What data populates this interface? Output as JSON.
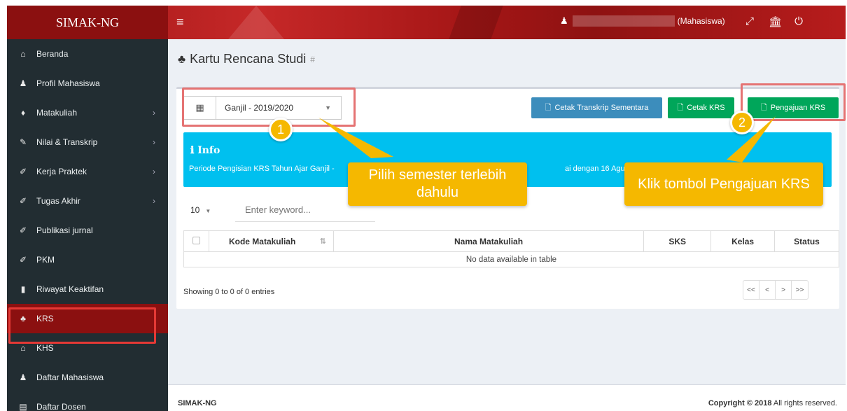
{
  "app": {
    "brand": "SIMAK-NG",
    "role": "(Mahasiswa)"
  },
  "icons": {
    "hamburger": "≡",
    "user": "♟",
    "expand": "⤢",
    "institution": "🏛",
    "power": "⏻",
    "calendar": "▦",
    "doc": "🗋"
  },
  "sidebar": {
    "items": [
      {
        "label": "Beranda",
        "icon": "home-icon",
        "glyph": "⌂",
        "chevron": false
      },
      {
        "label": "Profil Mahasiswa",
        "icon": "user-icon",
        "glyph": "♟",
        "chevron": false
      },
      {
        "label": "Matakuliah",
        "icon": "diamond-icon",
        "glyph": "♦",
        "chevron": true
      },
      {
        "label": "Nilai & Transkrip",
        "icon": "edit-icon",
        "glyph": "✎",
        "chevron": true
      },
      {
        "label": "Kerja Praktek",
        "icon": "pencil-icon",
        "glyph": "✐",
        "chevron": true
      },
      {
        "label": "Tugas Akhir",
        "icon": "pencil-icon",
        "glyph": "✐",
        "chevron": true
      },
      {
        "label": "Publikasi jurnal",
        "icon": "pencil-icon",
        "glyph": "✐",
        "chevron": false
      },
      {
        "label": "PKM",
        "icon": "pencil-icon",
        "glyph": "✐",
        "chevron": false
      },
      {
        "label": "Riwayat Keaktifan",
        "icon": "bookmark-icon",
        "glyph": "▮",
        "chevron": false
      },
      {
        "label": "KRS",
        "icon": "sitemap-icon",
        "glyph": "♣",
        "chevron": false,
        "active": true
      },
      {
        "label": "KHS",
        "icon": "graduation-icon",
        "glyph": "⌂",
        "chevron": false
      },
      {
        "label": "Daftar Mahasiswa",
        "icon": "users-icon",
        "glyph": "♟",
        "chevron": false
      },
      {
        "label": "Daftar Dosen",
        "icon": "list-icon",
        "glyph": "▤",
        "chevron": false
      }
    ],
    "chevron_glyph": "›"
  },
  "page": {
    "title": "Kartu Rencana Studi",
    "hash": "#",
    "title_icon": "♣"
  },
  "semester": {
    "value": "Ganjil - 2019/2020",
    "caret": "▼"
  },
  "buttons": {
    "cetak_transkrip": "Cetak Transkrip Sementara",
    "cetak_krs": "Cetak KRS",
    "pengajuan_krs": "Pengajuan KRS"
  },
  "info": {
    "title": "ℹ Info",
    "text_visible_left": "Periode Pengisian KRS Tahun Ajar Ganjil -",
    "text_visible_right": "ai dengan 16 Agust"
  },
  "table": {
    "length": "10",
    "length_caret": "▼",
    "search_placeholder": "Enter keyword...",
    "sort_icon": "⇅",
    "headers": [
      "Kode Matakuliah",
      "Nama Matakuliah",
      "SKS",
      "Kelas",
      "Status"
    ],
    "empty": "No data available in table",
    "showing": "Showing 0 to 0 of 0 entries",
    "pager": [
      "<<",
      "<",
      ">",
      ">>"
    ]
  },
  "annotations": {
    "step1": "1",
    "step2": "2",
    "callout1": "Pilih semester terlebih dahulu",
    "callout2": "Klik tombol Pengajuan KRS",
    "color": "#f5b800"
  },
  "footer": {
    "left": "SIMAK-NG",
    "right_bold": "Copyright © 2018",
    "right_rest": " All rights reserved."
  },
  "colors": {
    "topbar": "#b71c1c",
    "sidebar": "#222d32",
    "active": "#8b1010",
    "blue_btn": "#3c8dbc",
    "green_btn": "#00a65a",
    "info": "#00c0ef",
    "highlight": "#e53935"
  }
}
